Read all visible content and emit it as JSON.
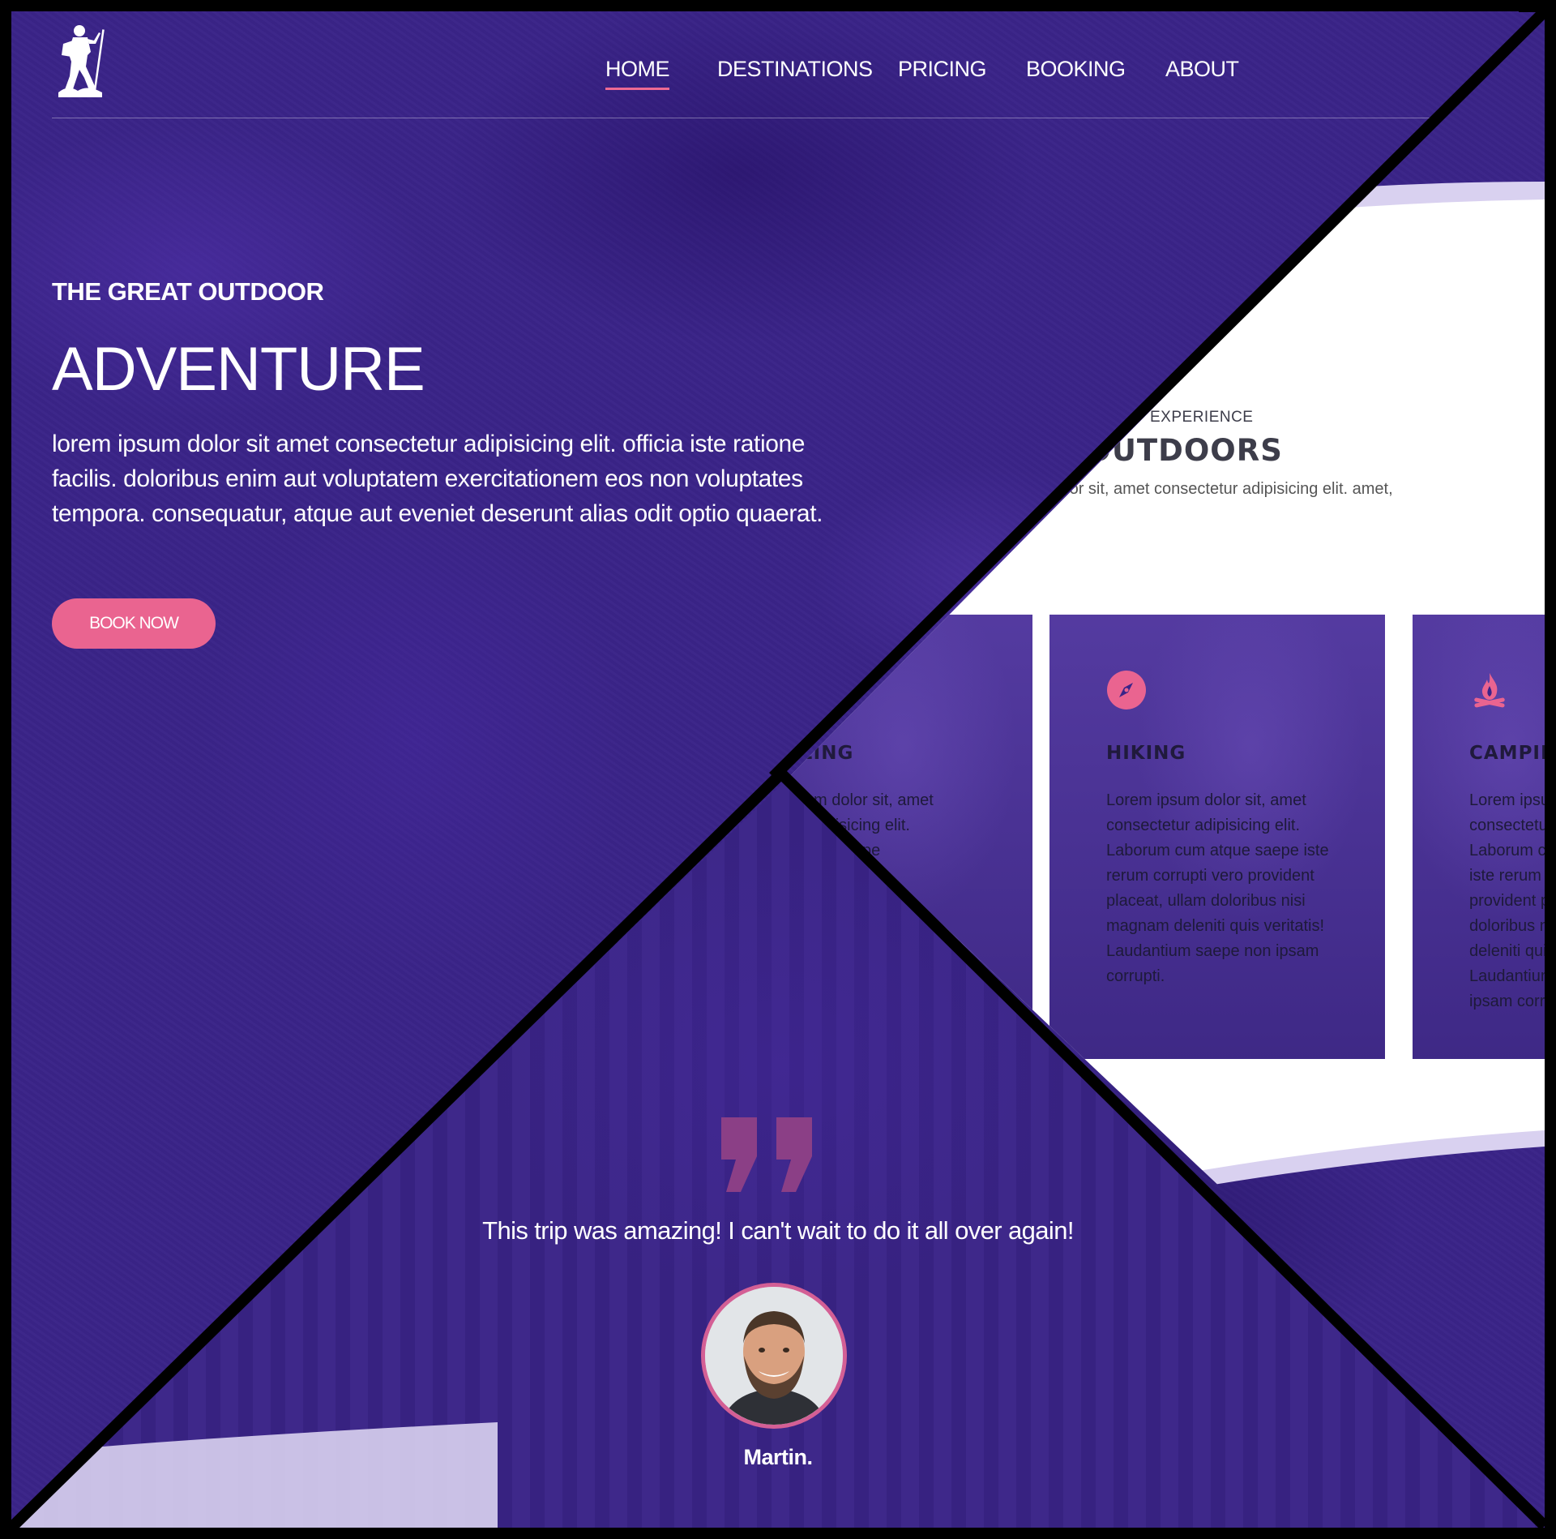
{
  "nav": {
    "items": [
      {
        "label": "HOME"
      },
      {
        "label": "DESTINATIONS"
      },
      {
        "label": "PRICING"
      },
      {
        "label": "BOOKING"
      },
      {
        "label": "ABOUT"
      }
    ]
  },
  "hero": {
    "eyebrow": "THE GREAT OUTDOOR",
    "title": "ADVENTURE",
    "text": "lorem ipsum dolor sit amet consectetur adipisicing elit. officia iste ratione facilis. doloribus enim aut voluptatem exercitationem eos non voluptates tempora. consequatur, atque aut eveniet deserunt alias odit optio quaerat.",
    "button_label": "BOOK NOW"
  },
  "experience": {
    "subtitle": "EXPERIENCE",
    "title": "RILLING OUTDOORS",
    "description": "olor sit, amet consectetur adipisicing elit. amet,",
    "cards": [
      {
        "title": "ZING",
        "icon": "compass-icon",
        "text": "m dolor sit, amet\ndipisicing elit.\nue saepe\nvero"
      },
      {
        "title": "HIKING",
        "icon": "compass-icon",
        "text": "Lorem ipsum dolor sit, amet consectetur adipisicing elit. Laborum cum atque saepe iste rerum corrupti vero provident placeat, ullam doloribus nisi magnam deleniti quis veritatis! Laudantium saepe non ipsam corrupti."
      },
      {
        "title": "CAMPING",
        "icon": "campfire-icon",
        "text": "Lorem ipsum\nconsectetur\nLaborum cu\niste rerum co\nprovident pl\ndoloribus nis\ndeleniti quis\nLaudantium\nipsam corrup"
      }
    ]
  },
  "testimonial": {
    "quote": "This trip was amazing! I can't wait to do it all over again!",
    "author": "Martin."
  },
  "colors": {
    "primary_purple": "#3a2488",
    "accent_pink": "#ea6490",
    "white": "#ffffff"
  }
}
